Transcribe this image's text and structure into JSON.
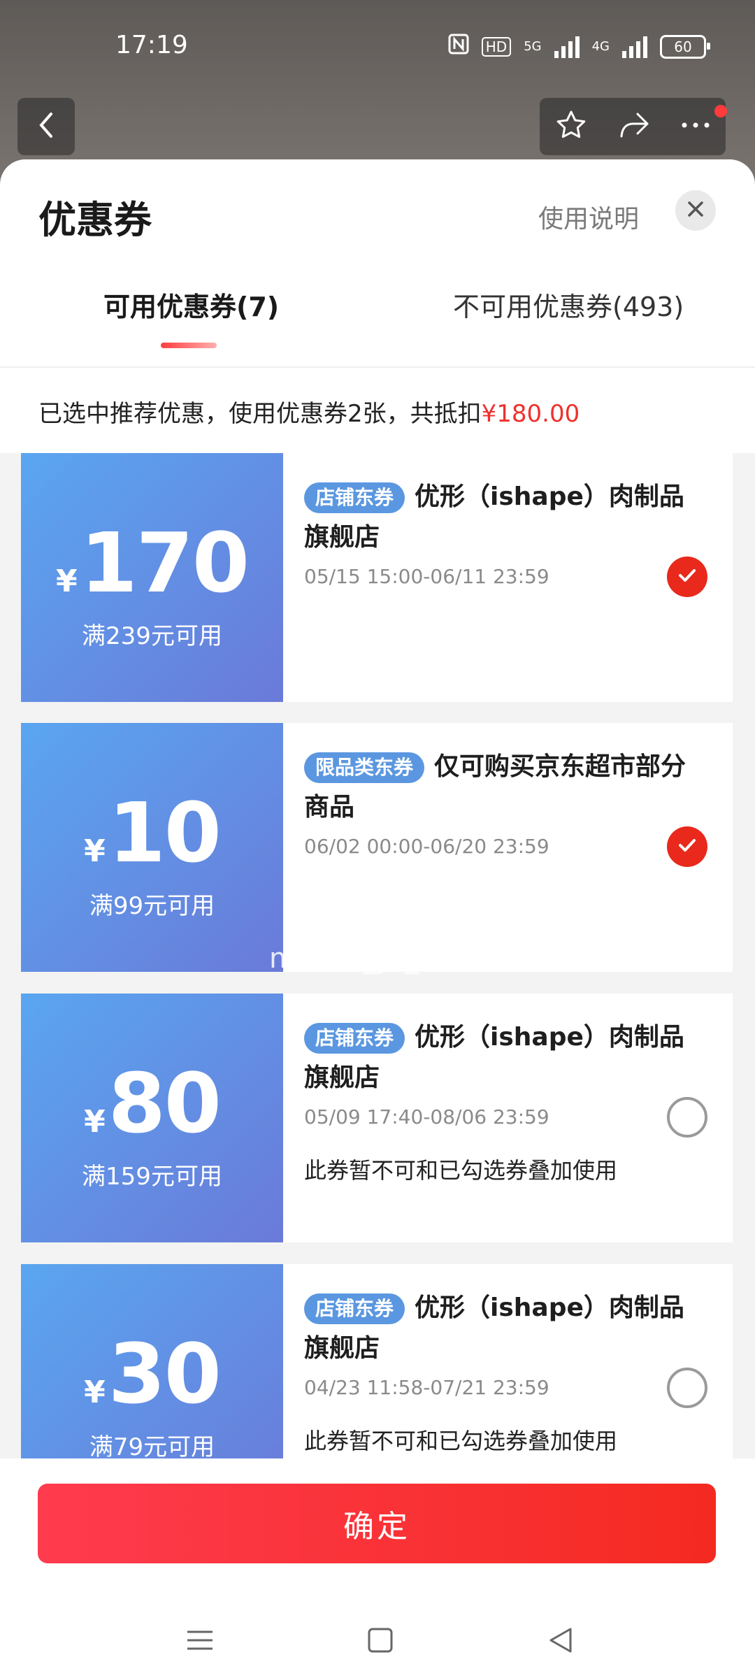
{
  "status_bar": {
    "time": "17:19",
    "hd_label": "HD",
    "net1": "5G",
    "net2": "4G",
    "battery": "60"
  },
  "colors": {
    "accent": "#f0302c",
    "coupon_blue": "#5b97e0"
  },
  "sheet": {
    "title": "优惠券",
    "usage_link": "使用说明",
    "tabs": [
      {
        "label": "可用优惠券(7)",
        "active": true
      },
      {
        "label": "不可用优惠券(493)",
        "active": false
      }
    ],
    "summary_prefix": "已选中推荐优惠，使用优惠券2张，共抵扣",
    "summary_amount": "¥180.00"
  },
  "coupons": [
    {
      "yen": "¥",
      "amount": "170",
      "condition": "满239元可用",
      "tag": "店铺东券",
      "title": "优形（ishape）肉制品旗舰店",
      "date": "05/15 15:00-06/11 23:59",
      "note": "",
      "selected": true
    },
    {
      "yen": "¥",
      "amount": "10",
      "condition": "满99元可用",
      "tag": "限品类东券",
      "title": "仅可购买京东超市部分商品",
      "date": "06/02 00:00-06/20 23:59",
      "note": "",
      "selected": true
    },
    {
      "yen": "¥",
      "amount": "80",
      "condition": "满159元可用",
      "tag": "店铺东券",
      "title": "优形（ishape）肉制品旗舰店",
      "date": "05/09 17:40-08/06 23:59",
      "note": "此券暂不可和已勾选券叠加使用",
      "selected": false
    },
    {
      "yen": "¥",
      "amount": "30",
      "condition": "满79元可用",
      "tag": "店铺东券",
      "title": "优形（ishape）肉制品旗舰店",
      "date": "04/23 11:58-07/21 23:59",
      "note": "此券暂不可和已勾选券叠加使用",
      "selected": false
    }
  ],
  "watermark": "mnbill_jc_1e",
  "confirm_label": "确定"
}
